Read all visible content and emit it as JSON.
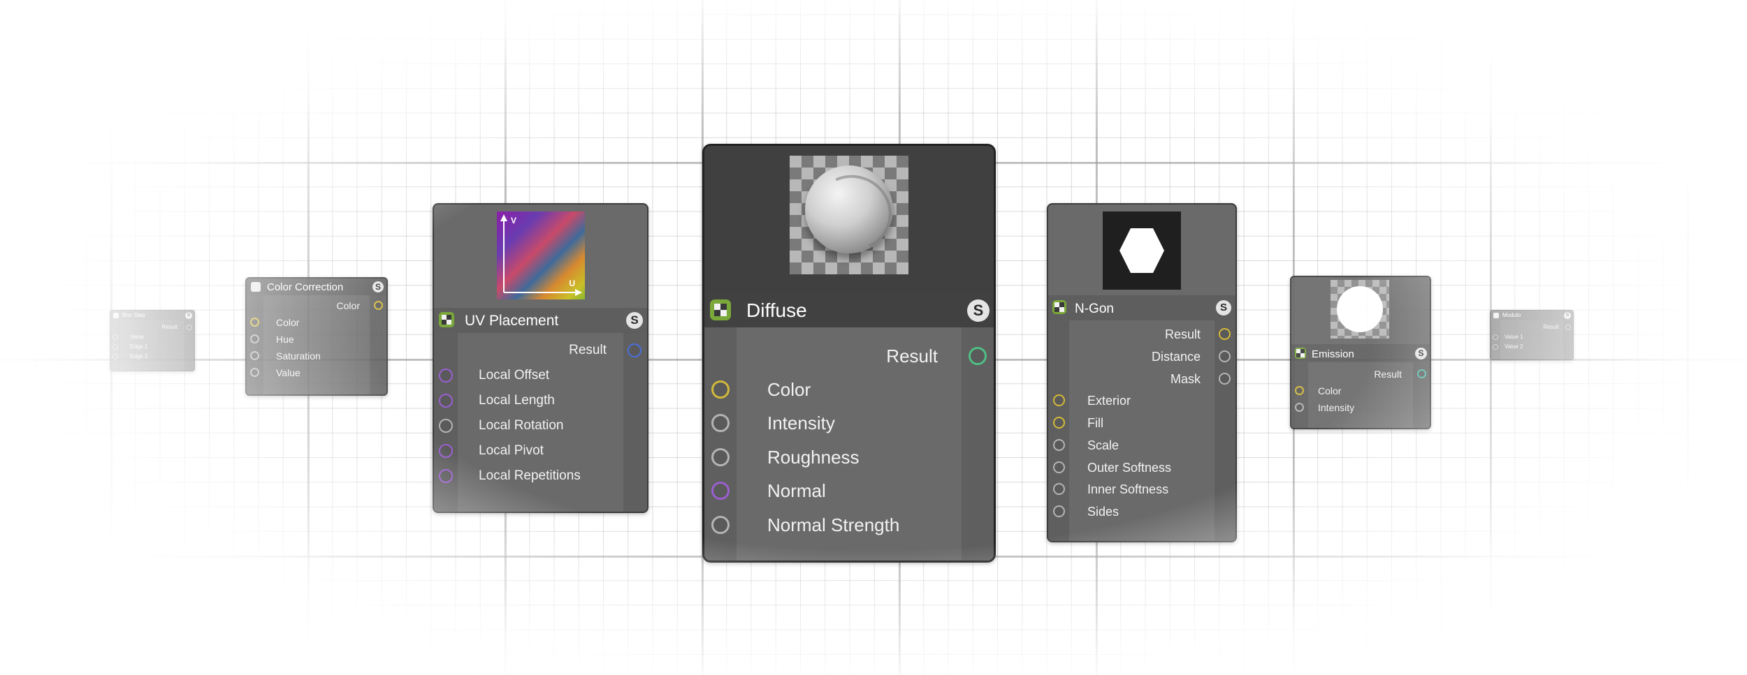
{
  "colors": {
    "socket_yellow": "#d2b93a",
    "socket_gray": "#b4b4b4",
    "socket_purple": "#9a5fd0",
    "socket_blue": "#4a6fd8",
    "socket_green": "#4fbf84",
    "socket_teal": "#4fb8a8",
    "node_body": "#6a6a6a",
    "node_header_dark": "#3f3f3f"
  },
  "nodes": {
    "box_step": {
      "title": "Box Step",
      "badge": "S",
      "outputs": [
        "Result"
      ],
      "inputs": [
        "Value",
        "Edge 1",
        "Edge 2"
      ]
    },
    "color_correction": {
      "title": "Color Correction",
      "badge": "S",
      "outputs": [
        "Color"
      ],
      "inputs": [
        "Color",
        "Hue",
        "Saturation",
        "Value"
      ]
    },
    "uv_placement": {
      "title": "UV Placement",
      "badge": "S",
      "preview_axis_v": "V",
      "preview_axis_u": "U",
      "outputs": [
        "Result"
      ],
      "inputs": [
        "Local Offset",
        "Local Length",
        "Local Rotation",
        "Local Pivot",
        "Local Repetitions"
      ]
    },
    "diffuse": {
      "title": "Diffuse",
      "badge": "S",
      "outputs": [
        "Result"
      ],
      "inputs": [
        "Color",
        "Intensity",
        "Roughness",
        "Normal",
        "Normal Strength"
      ]
    },
    "ngon": {
      "title": "N-Gon",
      "badge": "S",
      "outputs": [
        "Result",
        "Distance",
        "Mask"
      ],
      "inputs": [
        "Exterior",
        "Fill",
        "Scale",
        "Outer Softness",
        "Inner Softness",
        "Sides"
      ]
    },
    "emission": {
      "title": "Emission",
      "badge": "S",
      "outputs": [
        "Result"
      ],
      "inputs": [
        "Color",
        "Intensity"
      ]
    },
    "modulo": {
      "title": "Modulo",
      "badge": "S",
      "outputs": [
        "Result"
      ],
      "inputs": [
        "Value 1",
        "Value 2"
      ]
    }
  }
}
